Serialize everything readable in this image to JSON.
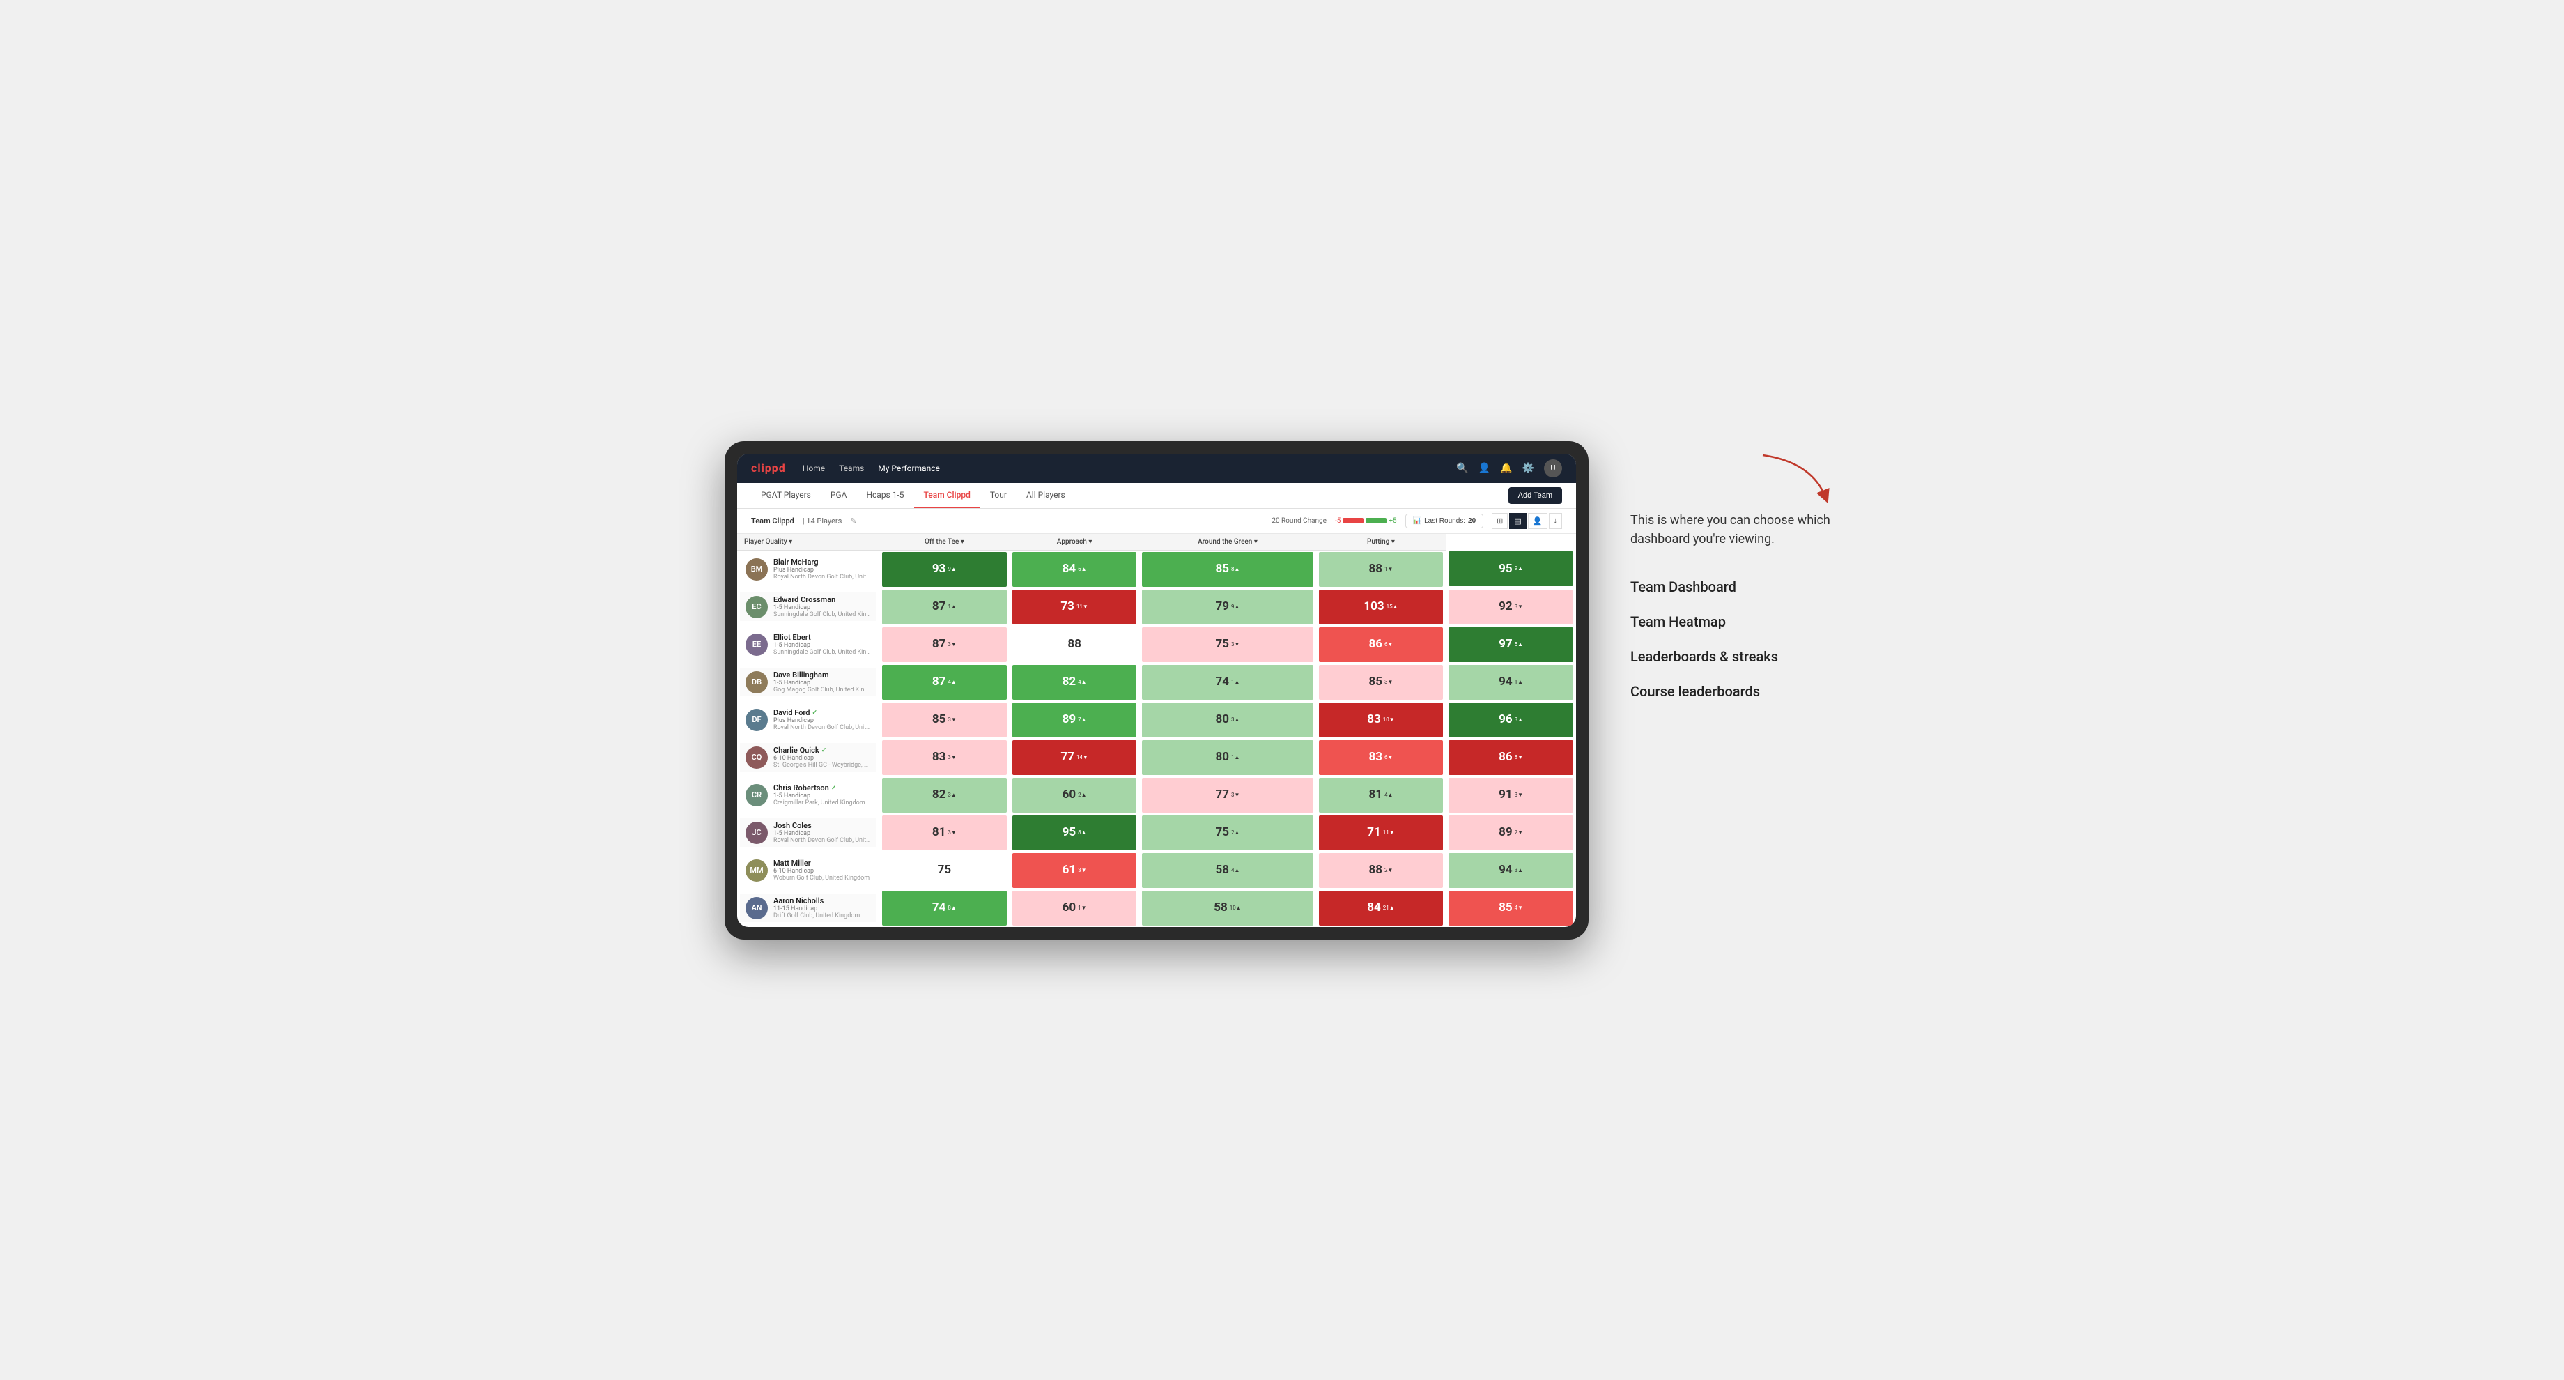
{
  "annotation": {
    "intro_text": "This is where you can choose which dashboard you're viewing.",
    "items": [
      "Team Dashboard",
      "Team Heatmap",
      "Leaderboards & streaks",
      "Course leaderboards"
    ]
  },
  "nav": {
    "logo": "clippd",
    "links": [
      "Home",
      "Teams",
      "My Performance"
    ],
    "active_link": "My Performance"
  },
  "sub_nav": {
    "items": [
      "PGAT Players",
      "PGA",
      "Hcaps 1-5",
      "Team Clippd",
      "Tour",
      "All Players"
    ],
    "active": "Team Clippd",
    "add_team_label": "Add Team"
  },
  "team_bar": {
    "name": "Team Clippd",
    "count": "14 Players",
    "round_change_label": "20 Round Change",
    "bar_neg": "-5",
    "bar_pos": "+5",
    "last_rounds_label": "Last Rounds:",
    "last_rounds_value": "20"
  },
  "table": {
    "headers": [
      "Player Quality ▾",
      "Off the Tee ▾",
      "Approach ▾",
      "Around the Green ▾",
      "Putting ▾"
    ],
    "players": [
      {
        "name": "Blair McHarg",
        "handicap": "Plus Handicap",
        "club": "Royal North Devon Golf Club, United Kingdom",
        "initials": "BM",
        "avatar_color": "#8B7355",
        "stats": [
          {
            "value": "93",
            "delta": "9",
            "dir": "up",
            "bg": "bg-green-dark"
          },
          {
            "value": "84",
            "delta": "6",
            "dir": "up",
            "bg": "bg-green-med"
          },
          {
            "value": "85",
            "delta": "8",
            "dir": "up",
            "bg": "bg-green-med"
          },
          {
            "value": "88",
            "delta": "1",
            "dir": "down",
            "bg": "bg-green-light"
          },
          {
            "value": "95",
            "delta": "9",
            "dir": "up",
            "bg": "bg-green-dark"
          }
        ]
      },
      {
        "name": "Edward Crossman",
        "handicap": "1-5 Handicap",
        "club": "Sunningdale Golf Club, United Kingdom",
        "initials": "EC",
        "avatar_color": "#6B8E6B",
        "stats": [
          {
            "value": "87",
            "delta": "1",
            "dir": "up",
            "bg": "bg-green-light"
          },
          {
            "value": "73",
            "delta": "11",
            "dir": "down",
            "bg": "bg-red-dark"
          },
          {
            "value": "79",
            "delta": "9",
            "dir": "up",
            "bg": "bg-green-light"
          },
          {
            "value": "103",
            "delta": "15",
            "dir": "up",
            "bg": "bg-red-dark"
          },
          {
            "value": "92",
            "delta": "3",
            "dir": "down",
            "bg": "bg-red-light"
          }
        ]
      },
      {
        "name": "Elliot Ebert",
        "handicap": "1-5 Handicap",
        "club": "Sunningdale Golf Club, United Kingdom",
        "initials": "EE",
        "avatar_color": "#7B6B8E",
        "stats": [
          {
            "value": "87",
            "delta": "3",
            "dir": "down",
            "bg": "bg-red-light"
          },
          {
            "value": "88",
            "delta": "",
            "dir": "",
            "bg": "bg-white"
          },
          {
            "value": "75",
            "delta": "3",
            "dir": "down",
            "bg": "bg-red-light"
          },
          {
            "value": "86",
            "delta": "6",
            "dir": "down",
            "bg": "bg-red-med"
          },
          {
            "value": "97",
            "delta": "5",
            "dir": "up",
            "bg": "bg-green-dark"
          }
        ]
      },
      {
        "name": "Dave Billingham",
        "handicap": "1-5 Handicap",
        "club": "Gog Magog Golf Club, United Kingdom",
        "initials": "DB",
        "avatar_color": "#8E7B5A",
        "stats": [
          {
            "value": "87",
            "delta": "4",
            "dir": "up",
            "bg": "bg-green-med"
          },
          {
            "value": "82",
            "delta": "4",
            "dir": "up",
            "bg": "bg-green-med"
          },
          {
            "value": "74",
            "delta": "1",
            "dir": "up",
            "bg": "bg-green-light"
          },
          {
            "value": "85",
            "delta": "3",
            "dir": "down",
            "bg": "bg-red-light"
          },
          {
            "value": "94",
            "delta": "1",
            "dir": "up",
            "bg": "bg-green-light"
          }
        ]
      },
      {
        "name": "David Ford",
        "handicap": "Plus Handicap",
        "club": "Royal North Devon Golf Club, United Kingdom",
        "initials": "DF",
        "verified": true,
        "avatar_color": "#5A7B8E",
        "stats": [
          {
            "value": "85",
            "delta": "3",
            "dir": "down",
            "bg": "bg-red-light"
          },
          {
            "value": "89",
            "delta": "7",
            "dir": "up",
            "bg": "bg-green-med"
          },
          {
            "value": "80",
            "delta": "3",
            "dir": "up",
            "bg": "bg-green-light"
          },
          {
            "value": "83",
            "delta": "10",
            "dir": "down",
            "bg": "bg-red-dark"
          },
          {
            "value": "96",
            "delta": "3",
            "dir": "up",
            "bg": "bg-green-dark"
          }
        ]
      },
      {
        "name": "Charlie Quick",
        "handicap": "6-10 Handicap",
        "club": "St. George's Hill GC - Weybridge, Surrey, Uni...",
        "initials": "CQ",
        "verified": true,
        "avatar_color": "#8E5A5A",
        "stats": [
          {
            "value": "83",
            "delta": "3",
            "dir": "down",
            "bg": "bg-red-light"
          },
          {
            "value": "77",
            "delta": "14",
            "dir": "down",
            "bg": "bg-red-dark"
          },
          {
            "value": "80",
            "delta": "1",
            "dir": "up",
            "bg": "bg-green-light"
          },
          {
            "value": "83",
            "delta": "6",
            "dir": "down",
            "bg": "bg-red-med"
          },
          {
            "value": "86",
            "delta": "8",
            "dir": "down",
            "bg": "bg-red-dark"
          }
        ]
      },
      {
        "name": "Chris Robertson",
        "handicap": "1-5 Handicap",
        "club": "Craigmillar Park, United Kingdom",
        "initials": "CR",
        "verified": true,
        "avatar_color": "#6B8E7B",
        "stats": [
          {
            "value": "82",
            "delta": "3",
            "dir": "up",
            "bg": "bg-green-light"
          },
          {
            "value": "60",
            "delta": "2",
            "dir": "up",
            "bg": "bg-green-light"
          },
          {
            "value": "77",
            "delta": "3",
            "dir": "down",
            "bg": "bg-red-light"
          },
          {
            "value": "81",
            "delta": "4",
            "dir": "up",
            "bg": "bg-green-light"
          },
          {
            "value": "91",
            "delta": "3",
            "dir": "down",
            "bg": "bg-red-light"
          }
        ]
      },
      {
        "name": "Josh Coles",
        "handicap": "1-5 Handicap",
        "club": "Royal North Devon Golf Club, United Kingdom",
        "initials": "JC",
        "avatar_color": "#7B5A6B",
        "stats": [
          {
            "value": "81",
            "delta": "3",
            "dir": "down",
            "bg": "bg-red-light"
          },
          {
            "value": "95",
            "delta": "8",
            "dir": "up",
            "bg": "bg-green-dark"
          },
          {
            "value": "75",
            "delta": "2",
            "dir": "up",
            "bg": "bg-green-light"
          },
          {
            "value": "71",
            "delta": "11",
            "dir": "down",
            "bg": "bg-red-dark"
          },
          {
            "value": "89",
            "delta": "2",
            "dir": "down",
            "bg": "bg-red-light"
          }
        ]
      },
      {
        "name": "Matt Miller",
        "handicap": "6-10 Handicap",
        "club": "Woburn Golf Club, United Kingdom",
        "initials": "MM",
        "avatar_color": "#8E8E5A",
        "stats": [
          {
            "value": "75",
            "delta": "",
            "dir": "",
            "bg": "bg-white"
          },
          {
            "value": "61",
            "delta": "3",
            "dir": "down",
            "bg": "bg-red-med"
          },
          {
            "value": "58",
            "delta": "4",
            "dir": "up",
            "bg": "bg-green-light"
          },
          {
            "value": "88",
            "delta": "2",
            "dir": "down",
            "bg": "bg-red-light"
          },
          {
            "value": "94",
            "delta": "3",
            "dir": "up",
            "bg": "bg-green-light"
          }
        ]
      },
      {
        "name": "Aaron Nicholls",
        "handicap": "11-15 Handicap",
        "club": "Drift Golf Club, United Kingdom",
        "initials": "AN",
        "avatar_color": "#5A6B8E",
        "stats": [
          {
            "value": "74",
            "delta": "8",
            "dir": "up",
            "bg": "bg-green-med"
          },
          {
            "value": "60",
            "delta": "1",
            "dir": "down",
            "bg": "bg-red-light"
          },
          {
            "value": "58",
            "delta": "10",
            "dir": "up",
            "bg": "bg-green-light"
          },
          {
            "value": "84",
            "delta": "21",
            "dir": "up",
            "bg": "bg-red-dark"
          },
          {
            "value": "85",
            "delta": "4",
            "dir": "down",
            "bg": "bg-red-med"
          }
        ]
      }
    ]
  }
}
